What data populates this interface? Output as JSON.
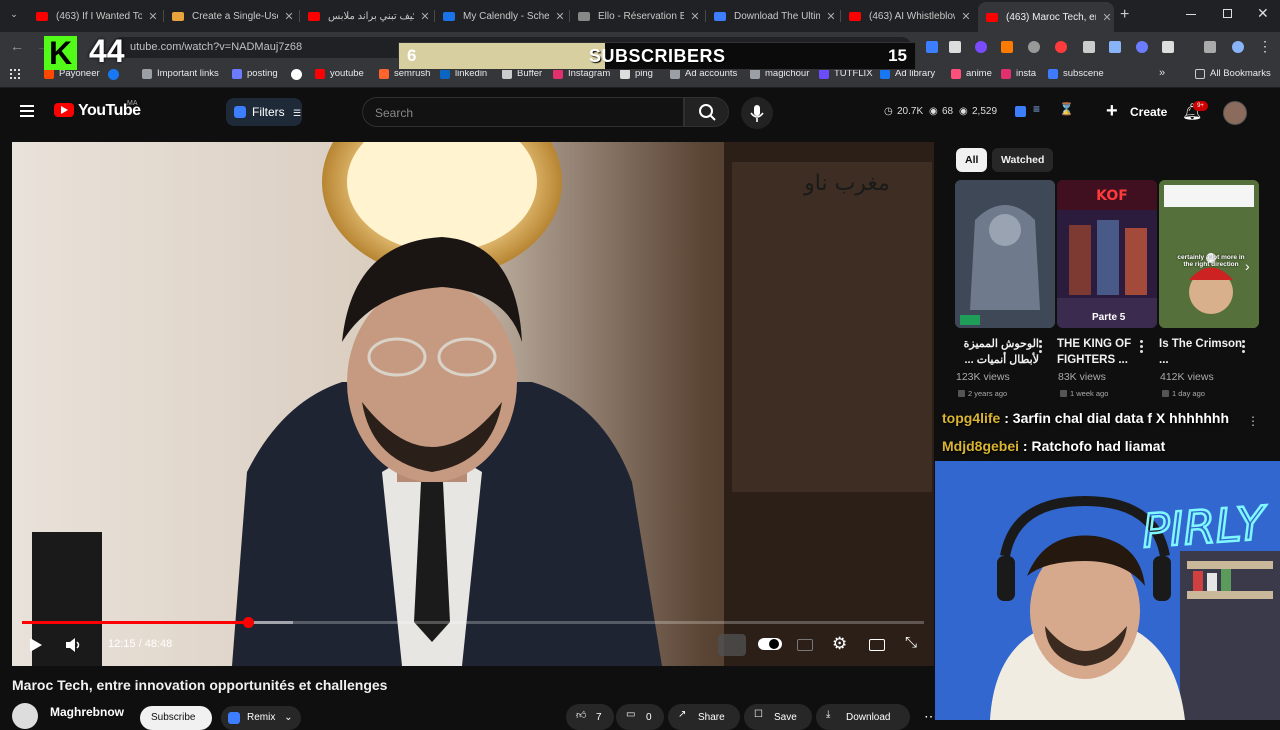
{
  "browser": {
    "tabs": [
      {
        "title": "(463) If I Wanted To",
        "favicon_color": "#ff0000"
      },
      {
        "title": "Create a Single-Use",
        "favicon_color": "#e8a33d"
      },
      {
        "title": "كيف تبني براند ملابس",
        "favicon_color": "#ff0000"
      },
      {
        "title": "My Calendly - Sched",
        "favicon_color": "#1a73e8"
      },
      {
        "title": "Ello - Réservation Bi",
        "favicon_color": "#888888"
      },
      {
        "title": "Download The Ultim",
        "favicon_color": "#3d7eff"
      },
      {
        "title": "(463) AI Whistleblow",
        "favicon_color": "#ff0000"
      },
      {
        "title": "(463) Maroc Tech, er",
        "favicon_color": "#ff0000",
        "active": true
      }
    ],
    "new_tab_label": "+",
    "url": "utube.com/watch?v=NADMauj7z68",
    "bookmarks": [
      {
        "label": "Payoneer",
        "color": "#ff4800"
      },
      {
        "label": "Important links",
        "color": "#9aa0a6"
      },
      {
        "label": "posting",
        "color": "#6b7cff"
      },
      {
        "label": "youtube",
        "color": "#ff0000"
      },
      {
        "label": "semrush",
        "color": "#ff642d"
      },
      {
        "label": "linkedin",
        "color": "#0a66c2"
      },
      {
        "label": "Buffer",
        "color": "#cccccc"
      },
      {
        "label": "Instagram",
        "color": "#e1306c"
      },
      {
        "label": "ping",
        "color": "#dddddd"
      },
      {
        "label": "Ad accounts",
        "color": "#9aa0a6"
      },
      {
        "label": "magichour",
        "color": "#9aa0a6"
      },
      {
        "label": "TUTFLIX",
        "color": "#6b4cff"
      },
      {
        "label": "Ad library",
        "color": "#1877f2"
      },
      {
        "label": "anime",
        "color": "#ff4f7b"
      },
      {
        "label": "insta",
        "color": "#e1306c"
      },
      {
        "label": "subscene",
        "color": "#3f7bff"
      }
    ],
    "all_bookmarks_label": "All Bookmarks"
  },
  "overlay": {
    "kick_logo_letter": "K",
    "kick_count": "44",
    "subs_current": "6",
    "subs_label": "SUBSCRIBERS",
    "subs_goal": "15",
    "subs_progress": 0.4
  },
  "youtube": {
    "logo_text": "YouTube",
    "country_code": "MA",
    "filters_label": "Filters",
    "search_placeholder": "Search",
    "stats": {
      "views": "20.7K",
      "watch": "68",
      "count": "2,529"
    },
    "create_label": "Create",
    "notification_count": "9+"
  },
  "player": {
    "time_label": "12:15 / 48:48",
    "played_fraction": 0.251,
    "buffered_fraction": 0.3,
    "watermark_text": "مغرب ناو"
  },
  "video": {
    "title": "Maroc Tech, entre innovation opportunités et challenges",
    "channel": "Maghrebnow",
    "subscribe_label": "Subscribe",
    "remix_label": "Remix",
    "like_count": "7",
    "comment_count": "0",
    "share_label": "Share",
    "save_label": "Save",
    "download_label": "Download"
  },
  "sidebar": {
    "chips": [
      "All",
      "Watched"
    ],
    "shorts": [
      {
        "title": "الوحوش المميزة لأبطال أنميات ...",
        "views": "123K views",
        "age": "2 years ago"
      },
      {
        "title": "THE KING OF FIGHTERS ...",
        "views": "83K views",
        "age": "1 week ago"
      },
      {
        "title": "Is The Crimson ...",
        "views": "412K views",
        "age": "1 day ago"
      }
    ],
    "short_badges": {
      "kof_label": "Parte 5",
      "crimson_caption": "certainly a lot more in the right direction"
    }
  },
  "chat": [
    {
      "user": "topg4life",
      "message": " : 3arfin chal dial data f X hhhhhhh"
    },
    {
      "user": "Mdjd8gebei",
      "message": " : Ratchofo had liamat"
    }
  ],
  "webcam": {
    "neon_text": "PIRLY"
  }
}
